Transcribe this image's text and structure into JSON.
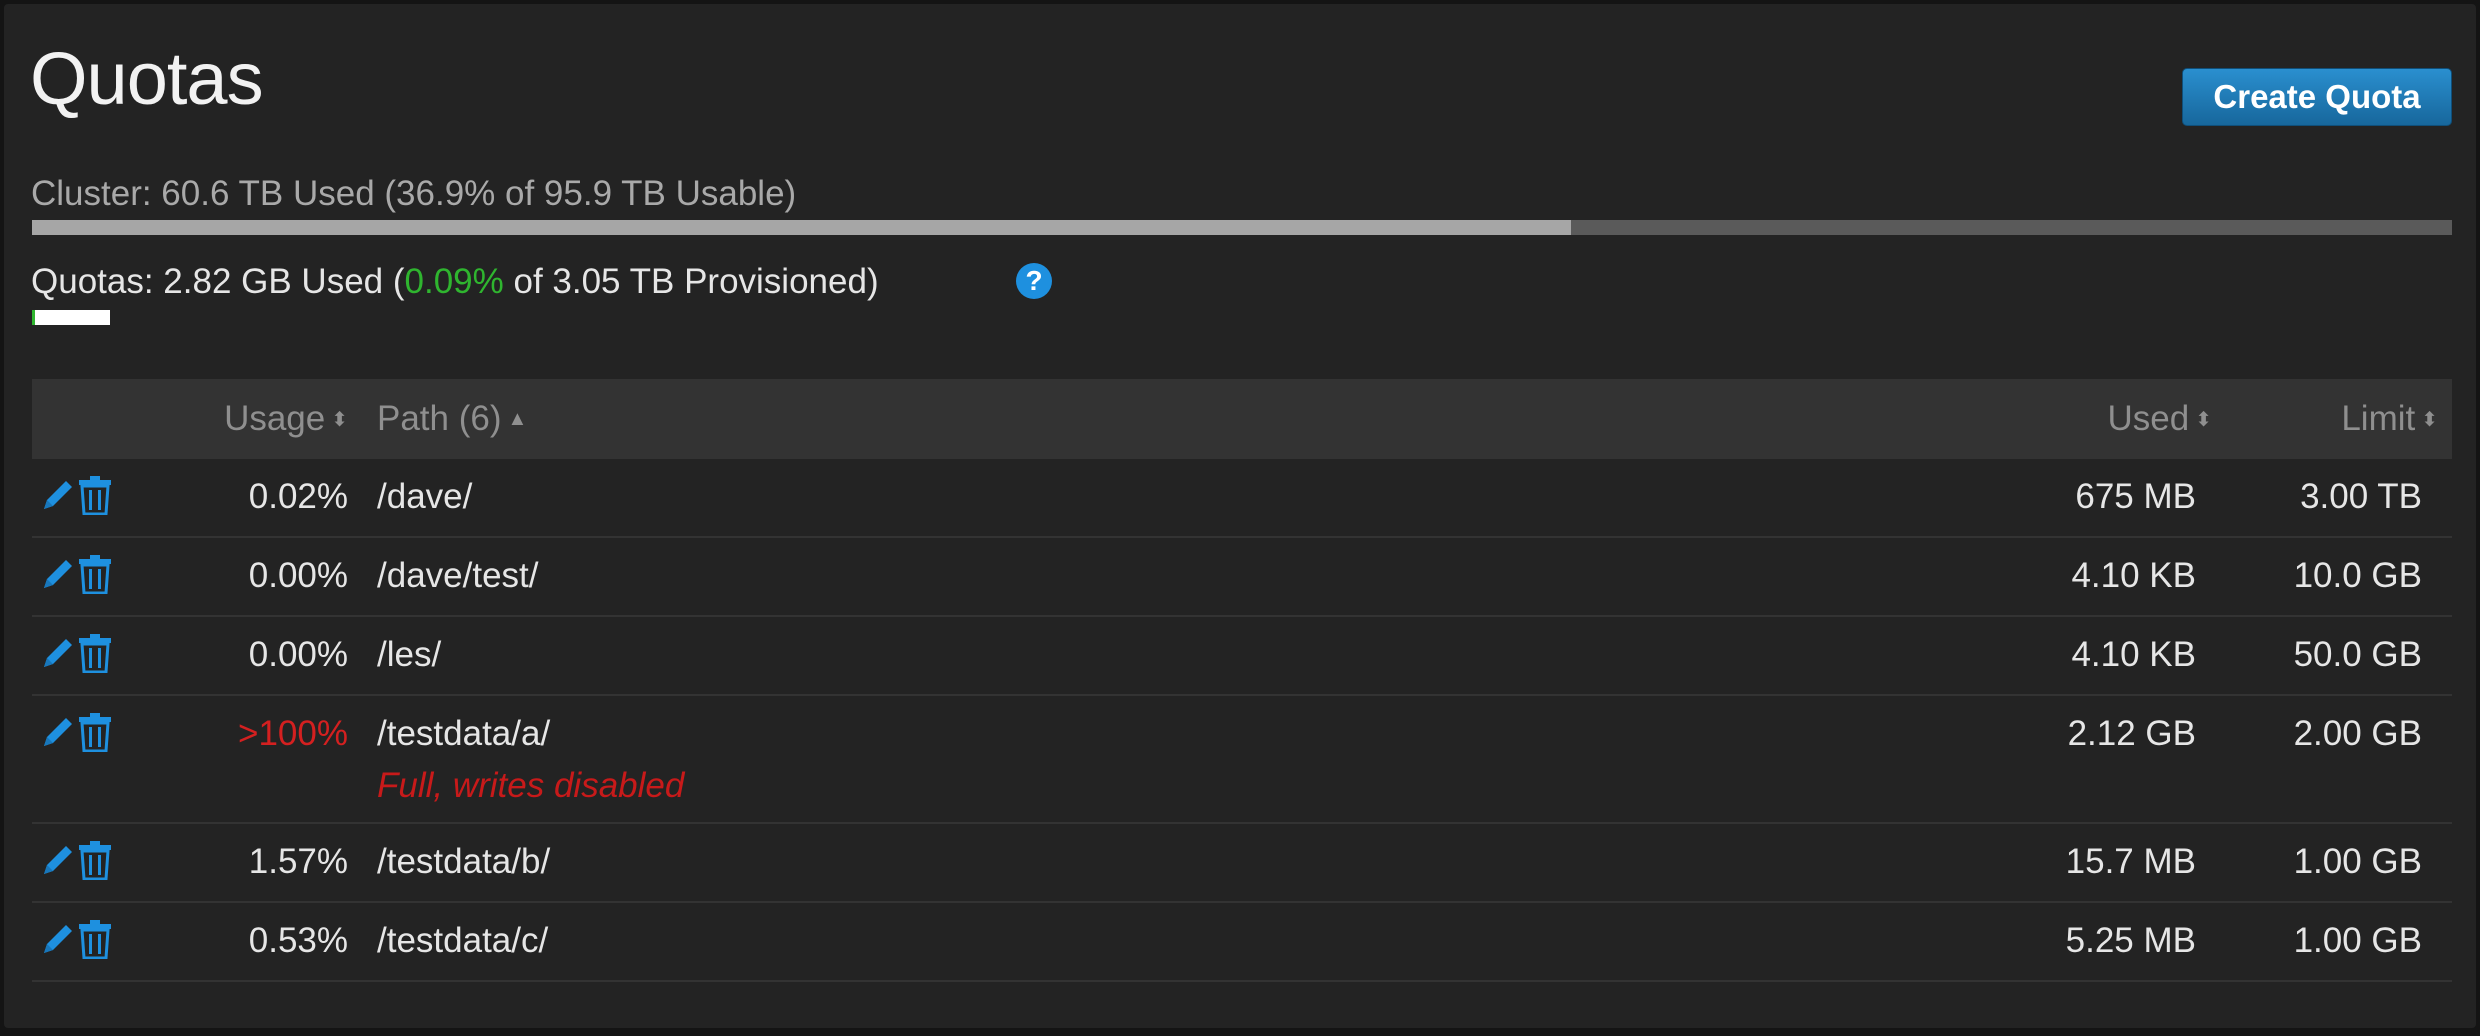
{
  "header": {
    "title": "Quotas",
    "create_button": "Create Quota"
  },
  "cluster": {
    "label": "Cluster: 60.6 TB Used (36.9% of 95.9 TB Usable)",
    "usage_fraction": 0.636
  },
  "quotas_summary": {
    "prefix": "Quotas: 2.82 GB Used (",
    "percent": "0.09%",
    "suffix": " of 3.05 TB Provisioned)",
    "usage_fraction": 0.0009,
    "help_icon": "?"
  },
  "table": {
    "columns": {
      "usage": "Usage",
      "path": "Path (6)",
      "used": "Used",
      "limit": "Limit"
    },
    "sort_icons": {
      "both": "⬍",
      "up": "▲"
    },
    "rows": [
      {
        "usage": "0.02%",
        "path": "/dave/",
        "used": "675 MB",
        "limit": "3.00 TB",
        "over": false,
        "warning": ""
      },
      {
        "usage": "0.00%",
        "path": "/dave/test/",
        "used": "4.10 KB",
        "limit": "10.0 GB",
        "over": false,
        "warning": ""
      },
      {
        "usage": "0.00%",
        "path": "/les/",
        "used": "4.10 KB",
        "limit": "50.0 GB",
        "over": false,
        "warning": ""
      },
      {
        "usage": ">100%",
        "path": "/testdata/a/",
        "used": "2.12 GB",
        "limit": "2.00 GB",
        "over": true,
        "warning": "Full, writes disabled"
      },
      {
        "usage": "1.57%",
        "path": "/testdata/b/",
        "used": "15.7 MB",
        "limit": "1.00 GB",
        "over": false,
        "warning": ""
      },
      {
        "usage": "0.53%",
        "path": "/testdata/c/",
        "used": "5.25 MB",
        "limit": "1.00 GB",
        "over": false,
        "warning": ""
      }
    ]
  },
  "colors": {
    "accent": "#1e90df",
    "ok": "#2fb52f",
    "danger": "#d42020"
  },
  "icons": {
    "edit": "pencil-icon",
    "delete": "trash-icon"
  }
}
